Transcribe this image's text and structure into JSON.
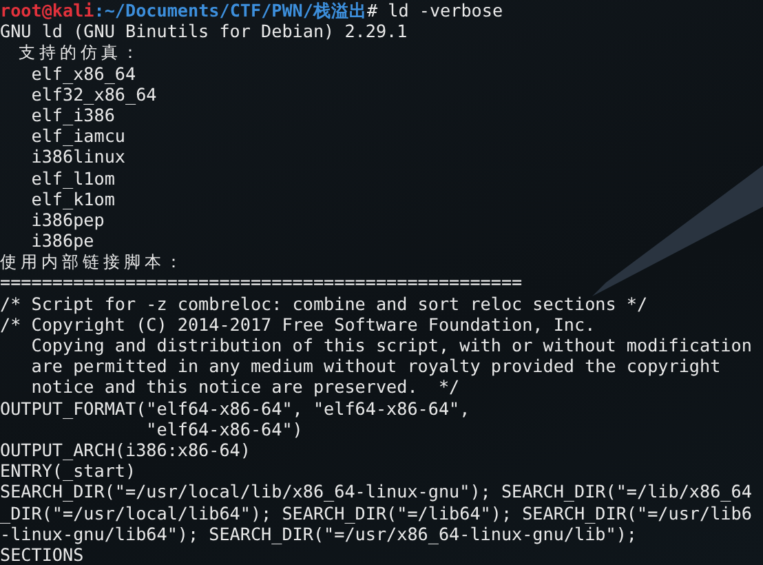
{
  "terminal": {
    "lines": [
      {
        "kind": "prompt",
        "user": "root@kali",
        "path": ":~/Documents/CTF/PWN/栈溢出",
        "command": "# ld -verbose"
      },
      {
        "kind": "plain",
        "text": "GNU ld (GNU Binutils for Debian) 2.29.1"
      },
      {
        "kind": "cjk",
        "text": "  支持的仿真："
      },
      {
        "kind": "plain",
        "text": "   elf_x86_64"
      },
      {
        "kind": "plain",
        "text": "   elf32_x86_64"
      },
      {
        "kind": "plain",
        "text": "   elf_i386"
      },
      {
        "kind": "plain",
        "text": "   elf_iamcu"
      },
      {
        "kind": "plain",
        "text": "   i386linux"
      },
      {
        "kind": "plain",
        "text": "   elf_l1om"
      },
      {
        "kind": "plain",
        "text": "   elf_k1om"
      },
      {
        "kind": "plain",
        "text": "   i386pep"
      },
      {
        "kind": "plain",
        "text": "   i386pe"
      },
      {
        "kind": "cjk",
        "text": "使用内部链接脚本："
      },
      {
        "kind": "plain",
        "text": "=================================================="
      },
      {
        "kind": "plain",
        "text": "/* Script for -z combreloc: combine and sort reloc sections */"
      },
      {
        "kind": "plain",
        "text": "/* Copyright (C) 2014-2017 Free Software Foundation, Inc."
      },
      {
        "kind": "plain",
        "text": "   Copying and distribution of this script, with or without modification"
      },
      {
        "kind": "plain",
        "text": "   are permitted in any medium without royalty provided the copyright"
      },
      {
        "kind": "plain",
        "text": "   notice and this notice are preserved.  */"
      },
      {
        "kind": "plain",
        "text": "OUTPUT_FORMAT(\"elf64-x86-64\", \"elf64-x86-64\","
      },
      {
        "kind": "plain",
        "text": "              \"elf64-x86-64\")"
      },
      {
        "kind": "plain",
        "text": "OUTPUT_ARCH(i386:x86-64)"
      },
      {
        "kind": "plain",
        "text": "ENTRY(_start)"
      },
      {
        "kind": "plain",
        "text": "SEARCH_DIR(\"=/usr/local/lib/x86_64-linux-gnu\"); SEARCH_DIR(\"=/lib/x86_64"
      },
      {
        "kind": "plain",
        "text": "_DIR(\"=/usr/local/lib64\"); SEARCH_DIR(\"=/lib64\"); SEARCH_DIR(\"=/usr/lib6"
      },
      {
        "kind": "plain",
        "text": "-linux-gnu/lib64\"); SEARCH_DIR(\"=/usr/x86_64-linux-gnu/lib\");"
      },
      {
        "kind": "plain",
        "text": "SECTIONS"
      }
    ]
  }
}
